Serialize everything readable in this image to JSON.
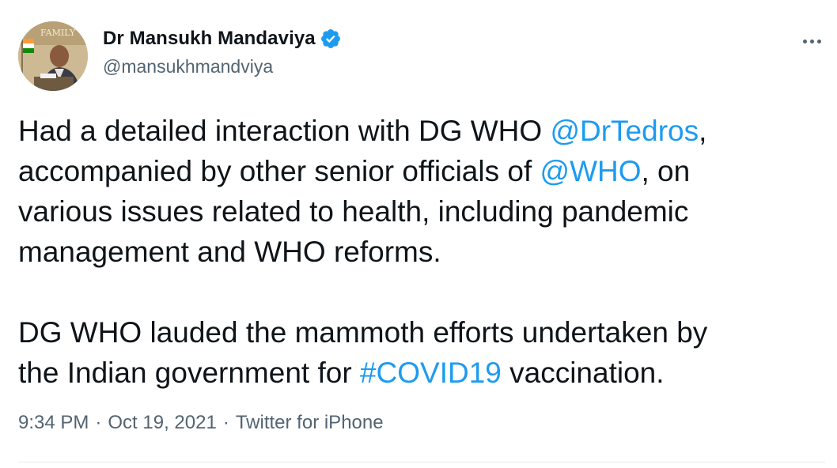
{
  "author": {
    "display_name": "Dr Mansukh Mandaviya",
    "handle": "@mansukhmandviya",
    "verified": true,
    "avatar_icon": "profile-photo",
    "avatar_text": "FAMILY"
  },
  "tweet": {
    "paragraph1": {
      "t1": "Had a detailed interaction with DG WHO ",
      "mention1": "@DrTedros",
      "t2": ",\naccompanied by other senior officials of ",
      "mention2": "@WHO",
      "t3": ", on\nvarious issues related to health, including pandemic\nmanagement and WHO reforms."
    },
    "paragraph2": {
      "t1": "DG WHO lauded the mammoth efforts undertaken by\nthe Indian government for ",
      "hashtag": "#COVID19",
      "t2": " vaccination."
    }
  },
  "meta": {
    "time": "9:34 PM",
    "separator": "·",
    "date": "Oct 19, 2021",
    "source": "Twitter for iPhone"
  },
  "colors": {
    "link": "#1d9bf0",
    "text": "#0f1419",
    "muted": "#536471"
  },
  "icons": {
    "verified": "verified-badge-icon",
    "more": "more-options-icon"
  }
}
